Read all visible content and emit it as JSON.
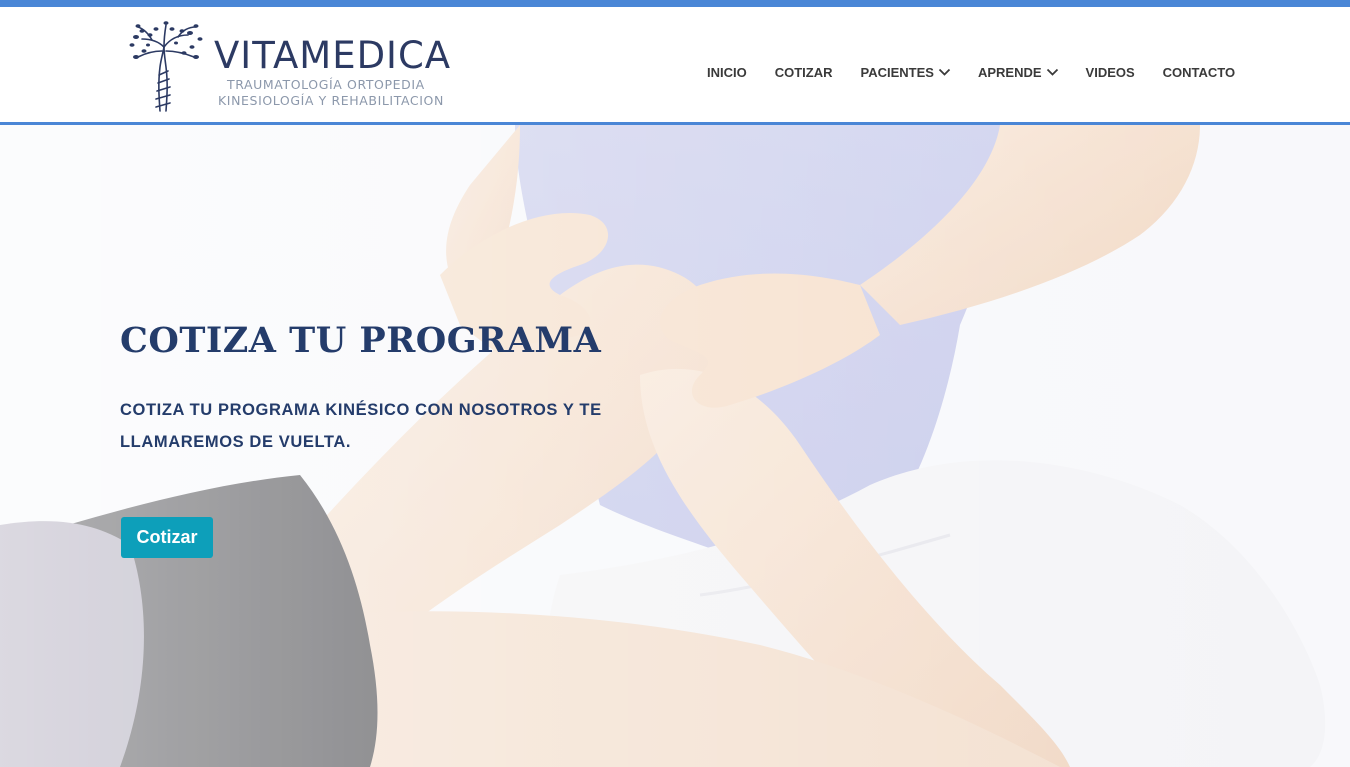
{
  "colors": {
    "accent_bar": "#4a86d6",
    "brand_navy": "#2c3a63",
    "brand_gray": "#8c98ab",
    "hero_text": "#243c6b",
    "cta_bg": "#0d9fba",
    "nav_text": "#3a3a3a"
  },
  "brand": {
    "name_part1": "VITA",
    "name_part2": "MEDICA",
    "subtitle_line1": "TRAUMATOLOGÍA  ORTOPEDIA",
    "subtitle_line2": "KINESIOLOGÍA Y REHABILITACION",
    "logo_icon": "tree-icon"
  },
  "nav": {
    "items": [
      {
        "label": "INICIO",
        "has_dropdown": false
      },
      {
        "label": "COTIZAR",
        "has_dropdown": false
      },
      {
        "label": "PACIENTES",
        "has_dropdown": true
      },
      {
        "label": "APRENDE",
        "has_dropdown": true
      },
      {
        "label": "VIDEOS",
        "has_dropdown": false
      },
      {
        "label": "CONTACTO",
        "has_dropdown": false
      }
    ],
    "dropdown_icon": "chevron-down-icon"
  },
  "hero": {
    "title": "COTIZA TU PROGRAMA",
    "text_line1": "COTIZA TU PROGRAMA KINÉSICO CON NOSOTROS Y TE",
    "text_line2": "LLAMAREMOS DE VUELTA.",
    "button_label": "Cotizar",
    "background_image": "physiotherapy-knee-photo"
  }
}
